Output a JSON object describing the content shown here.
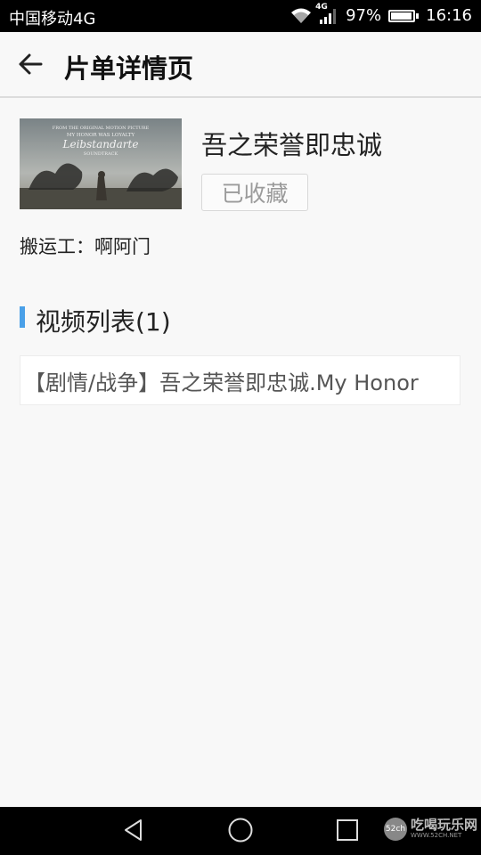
{
  "status_bar": {
    "carrier": "中国移动4G",
    "network_badge": "4G",
    "battery_percent": "97%",
    "battery_level": 0.97,
    "time": "16:16",
    "icons": [
      "wifi-icon",
      "signal-icon",
      "battery-icon"
    ]
  },
  "app_bar": {
    "back_icon": "arrow-left-icon",
    "title": "片单详情页"
  },
  "album": {
    "title": "吾之荣誉即忠诚",
    "favorite_label": "已收藏",
    "uploader_line": "搬运工：啊阿门",
    "cover_texts": {
      "top_line": "FROM THE ORIGINAL MOTION PICTURE",
      "tagline": "MY HONOR WAS LOYALTY",
      "name": "Leibstandarte",
      "subtitle": "SOUNDTRACK"
    }
  },
  "videos_section": {
    "title": "视频列表(1)",
    "items": [
      {
        "title": "【剧情/战争】吾之荣誉即忠诚.My Honor"
      }
    ]
  },
  "nav_bar": {
    "icons": [
      "back-triangle-icon",
      "home-circle-icon",
      "recents-square-icon"
    ]
  },
  "watermark": {
    "badge": "52ch",
    "name": "吃喝玩乐网",
    "url": "WWW.52CH.NET"
  },
  "colors": {
    "accent": "#4aa0e8",
    "background": "#f8f8f8",
    "status_bar": "#000000"
  }
}
